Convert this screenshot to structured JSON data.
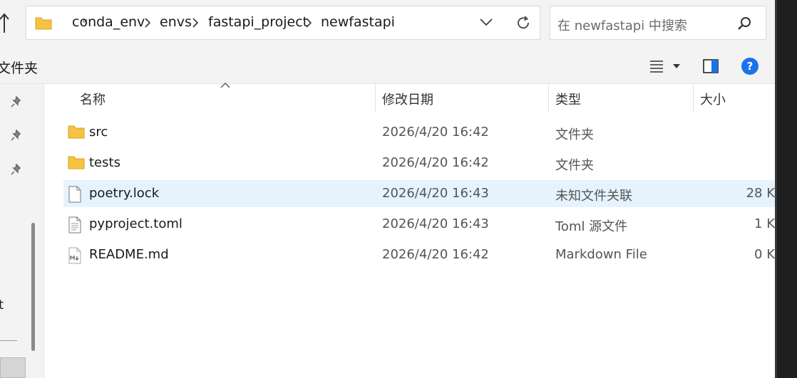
{
  "address_bar": {
    "overflow_glyph": "«",
    "crumbs": [
      "conda_env",
      "envs",
      "fastapi_project",
      "newfastapi"
    ]
  },
  "search": {
    "placeholder": "在 newfastapi 中搜索"
  },
  "toolbar": {
    "new_folder_label_partial": "文件夹"
  },
  "columns": {
    "name": "名称",
    "date_modified": "修改日期",
    "type": "类型",
    "size": "大小"
  },
  "files": [
    {
      "name": "src",
      "date": "2026/4/20 16:42",
      "type": "文件夹",
      "size": "",
      "icon": "folder-icon"
    },
    {
      "name": "tests",
      "date": "2026/4/20 16:42",
      "type": "文件夹",
      "size": "",
      "icon": "folder-icon"
    },
    {
      "name": "poetry.lock",
      "date": "2026/4/20 16:43",
      "type": "未知文件关联",
      "size": "28 K",
      "icon": "file-icon",
      "selected": true
    },
    {
      "name": "pyproject.toml",
      "date": "2026/4/20 16:43",
      "type": "Toml 源文件",
      "size": "1 K",
      "icon": "text-file-icon"
    },
    {
      "name": "README.md",
      "date": "2026/4/20 16:42",
      "type": "Markdown File",
      "size": "0 K",
      "icon": "markdown-file-icon"
    }
  ],
  "nav_pane": {
    "partial_text": "t"
  },
  "colors": {
    "folder": "#f5c242",
    "selected_row": "#e5f3ff",
    "help_blue": "#1a73e8",
    "chrome_bg": "#f3f3f3"
  }
}
